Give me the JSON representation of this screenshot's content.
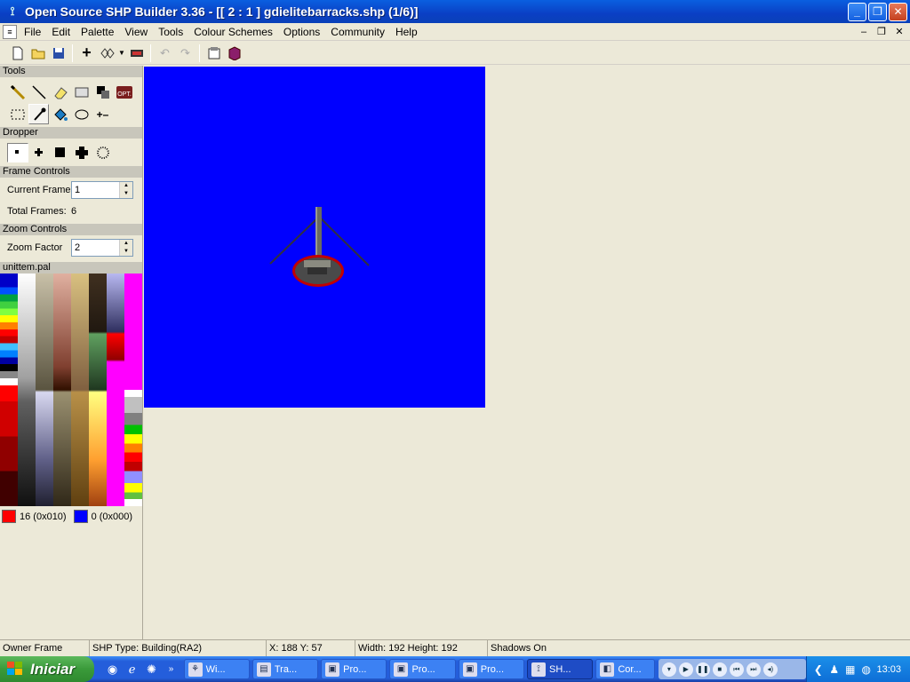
{
  "window": {
    "title": "Open Source SHP Builder 3.36 - [[ 2 : 1 ] gdielitebarracks.shp (1/6)]",
    "minimize_label": "_",
    "maximize_label": "❐",
    "close_label": "✕"
  },
  "menu": {
    "items": [
      "File",
      "Edit",
      "Palette",
      "View",
      "Tools",
      "Colour Schemes",
      "Options",
      "Community",
      "Help"
    ]
  },
  "panel": {
    "tools_header": "Tools",
    "dropper_header": "Dropper",
    "frame_header": "Frame Controls",
    "current_frame_label": "Current Frame",
    "current_frame_value": "1",
    "total_frames_label": "Total Frames:",
    "total_frames_value": "6",
    "zoom_header": "Zoom Controls",
    "zoom_label": "Zoom Factor",
    "zoom_value": "2",
    "palette_header": "unittem.pal",
    "primary_color_label": "16 (0x010)",
    "secondary_color_label": "0 (0x000)",
    "primary_color": "#ff0000",
    "secondary_color": "#0000ff",
    "opt_label": "OPT."
  },
  "canvas": {
    "background_color": "#0000ff"
  },
  "status": {
    "owner": "Owner Frame",
    "shp_type": "SHP Type: Building(RA2)",
    "coords": "X: 188 Y: 57",
    "size": "Width: 192 Height: 192",
    "shadows": "Shadows On"
  },
  "taskbar": {
    "start_label": "Iniciar",
    "tasks": [
      "Wi...",
      "Tra...",
      "Pro...",
      "Pro...",
      "Pro...",
      "SH...",
      "Cor..."
    ],
    "clock": "13:03"
  }
}
